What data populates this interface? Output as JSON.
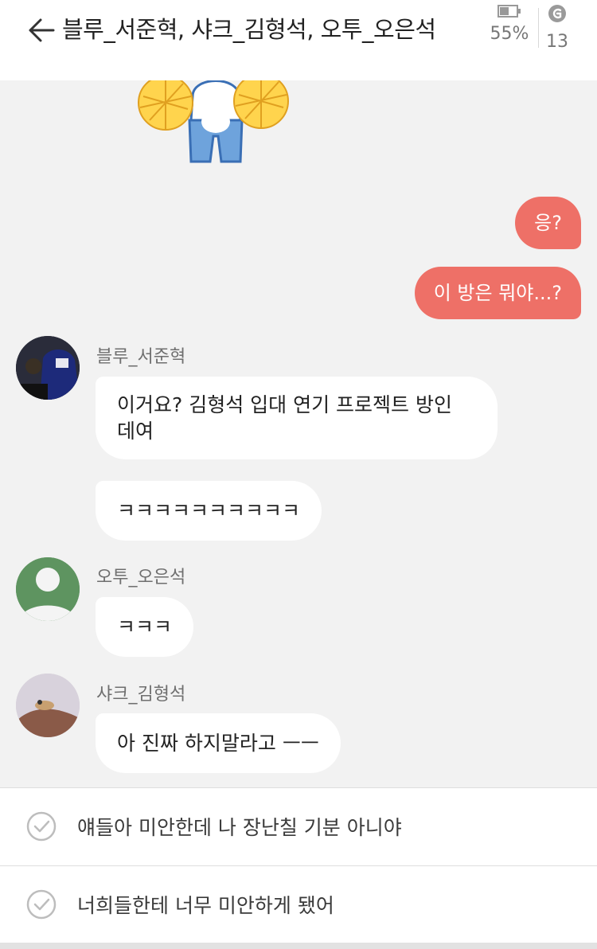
{
  "header": {
    "title": "블루_서준혁, 샤크_김형석, 오투_오은석",
    "battery_percent": "55%",
    "coins": "13"
  },
  "messages": {
    "me": [
      "응?",
      "이 방은 뭐야...?"
    ],
    "blue": {
      "sender": "블루_서준혁",
      "line1": "이거요? 김형석 입대 연기 프로젝트 방인",
      "line2": "데여",
      "msg2": "ㅋㅋㅋㅋㅋㅋㅋㅋㅋㅋ"
    },
    "otu": {
      "sender": "오투_오은석",
      "msg1": "ㅋㅋㅋ"
    },
    "shark": {
      "sender": "샤크_김형석",
      "msg1": "아 진짜 하지말라고 ㅡㅡ"
    }
  },
  "choices": [
    "얘들아 미안한데 나 장난칠 기분 아니야",
    "너희들한테 너무 미안하게 됐어"
  ],
  "colors": {
    "my_bubble": "#ee7067",
    "background": "#f2f2f2"
  }
}
